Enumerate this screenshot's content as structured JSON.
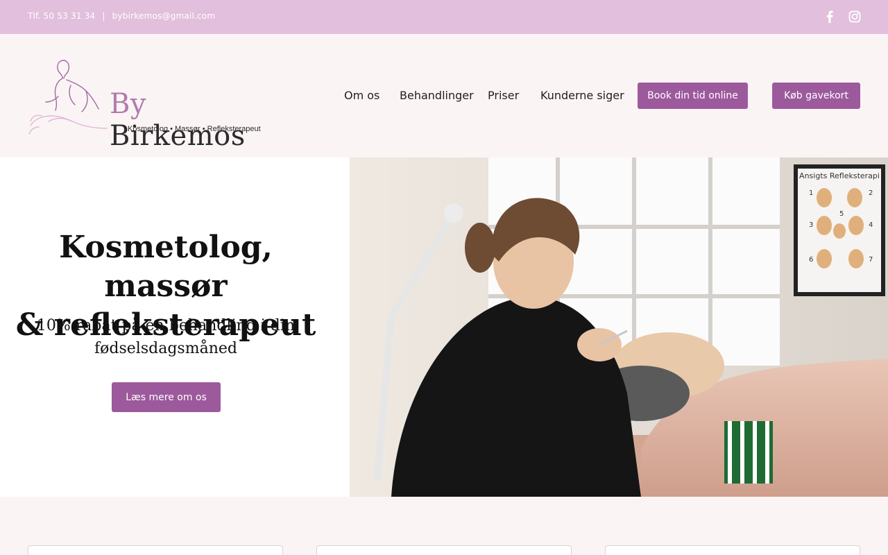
{
  "topbar": {
    "phone": "Tlf. 50 53 31 34",
    "separator": "|",
    "email": "bybirkemos@gmail.com",
    "social": [
      "facebook-icon",
      "instagram-icon"
    ]
  },
  "logo": {
    "prefix": "By",
    "name": "Birkemos",
    "tagline": "Kosmetolog • Massør • Refleksterapeut"
  },
  "nav": {
    "items": [
      "Om os",
      "Behandlinger",
      "Priser",
      "Kunderne siger"
    ],
    "book_label": "Book din tid online",
    "giftcard_label": "Køb gavekort"
  },
  "hero": {
    "title_line1": "Kosmetolog, massør",
    "title_line2": "& refleksterapeut",
    "subtitle_line1": "10% rabat på en behandling i din",
    "subtitle_line2": "fødselsdagsmåned",
    "cta_label": "Læs mere om os",
    "poster_title": "Ansigts Refleksterapi",
    "poster_numbers": [
      "1",
      "2",
      "3",
      "4",
      "5",
      "6",
      "7"
    ]
  },
  "colors": {
    "accent": "#9c5a9c",
    "topbar": "#e2bfdc",
    "background": "#fbf4f5"
  }
}
